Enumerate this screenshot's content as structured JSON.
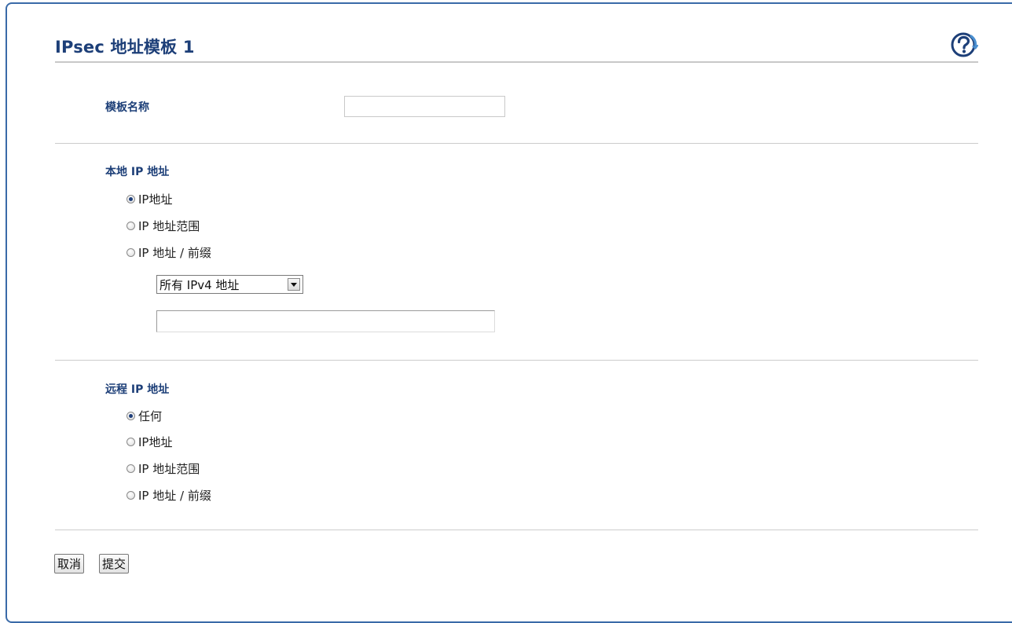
{
  "header": {
    "title": "IPsec 地址模板 1",
    "help_icon": "help-question-icon"
  },
  "template_name": {
    "label": "模板名称",
    "value": "",
    "placeholder": ""
  },
  "local_ip": {
    "heading": "本地 IP 地址",
    "options": [
      {
        "label": "IP地址",
        "checked": true
      },
      {
        "label": "IP 地址范围",
        "checked": false
      },
      {
        "label": "IP 地址 / 前缀",
        "checked": false
      }
    ],
    "select_value": "所有 IPv4 地址",
    "address_value": ""
  },
  "remote_ip": {
    "heading": "远程 IP 地址",
    "options": [
      {
        "label": "任何",
        "checked": true
      },
      {
        "label": "IP地址",
        "checked": false
      },
      {
        "label": "IP 地址范围",
        "checked": false
      },
      {
        "label": "IP 地址 / 前缀",
        "checked": false
      }
    ]
  },
  "buttons": {
    "cancel": "取消",
    "submit": "提交"
  },
  "colors": {
    "frame_border": "#3a6aa8",
    "title": "#1d3f78",
    "help_icon": "#1d3f78",
    "help_accent": "#4a8fd0"
  }
}
